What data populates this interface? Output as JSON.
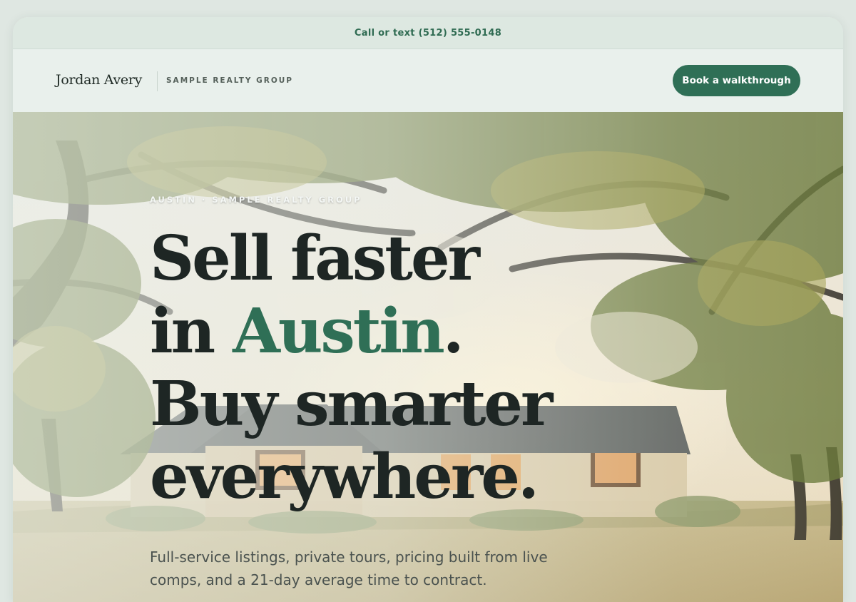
{
  "topbar": {
    "contact": "Call or text (512) 555-0148"
  },
  "nav": {
    "brand_name": "Jordan Avery",
    "brand_sub": "SAMPLE REALTY GROUP",
    "cta_label": "Book a walkthrough"
  },
  "hero": {
    "eyebrow": "AUSTIN · SAMPLE REALTY GROUP",
    "headline": {
      "line1": "Sell faster",
      "line2_prefix": "in ",
      "line2_accent": "Austin",
      "line2_suffix": ".",
      "line3": "Buy smarter",
      "line4": "everywhere."
    },
    "lede": "Full-service listings, private tours, pricing built from live comps, and a 21-day average time to contract.",
    "image": "house-under-oak-trees-photo"
  },
  "colors": {
    "accent": "#2f6f56",
    "page_bg": "#dfe7e2",
    "headline": "#1e2624"
  }
}
